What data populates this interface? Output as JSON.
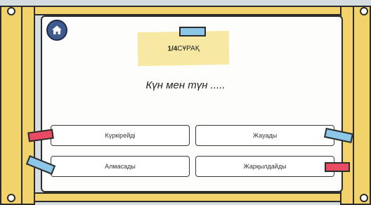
{
  "home": {
    "icon": "home-icon"
  },
  "progress": {
    "number": "1/4",
    "label": " СҰРАҚ"
  },
  "question": {
    "text": "Күн мен түн ....."
  },
  "answers": [
    {
      "label": "Күркірейді"
    },
    {
      "label": "Жауады"
    },
    {
      "label": "Алмасады"
    },
    {
      "label": "Жарқылдайды"
    }
  ],
  "colors": {
    "frame": "#f2d36b",
    "tape_blue": "#8cc7e8",
    "tape_red": "#e94a64",
    "home": "#3f5a8c",
    "sticky": "#f7e9a3"
  }
}
